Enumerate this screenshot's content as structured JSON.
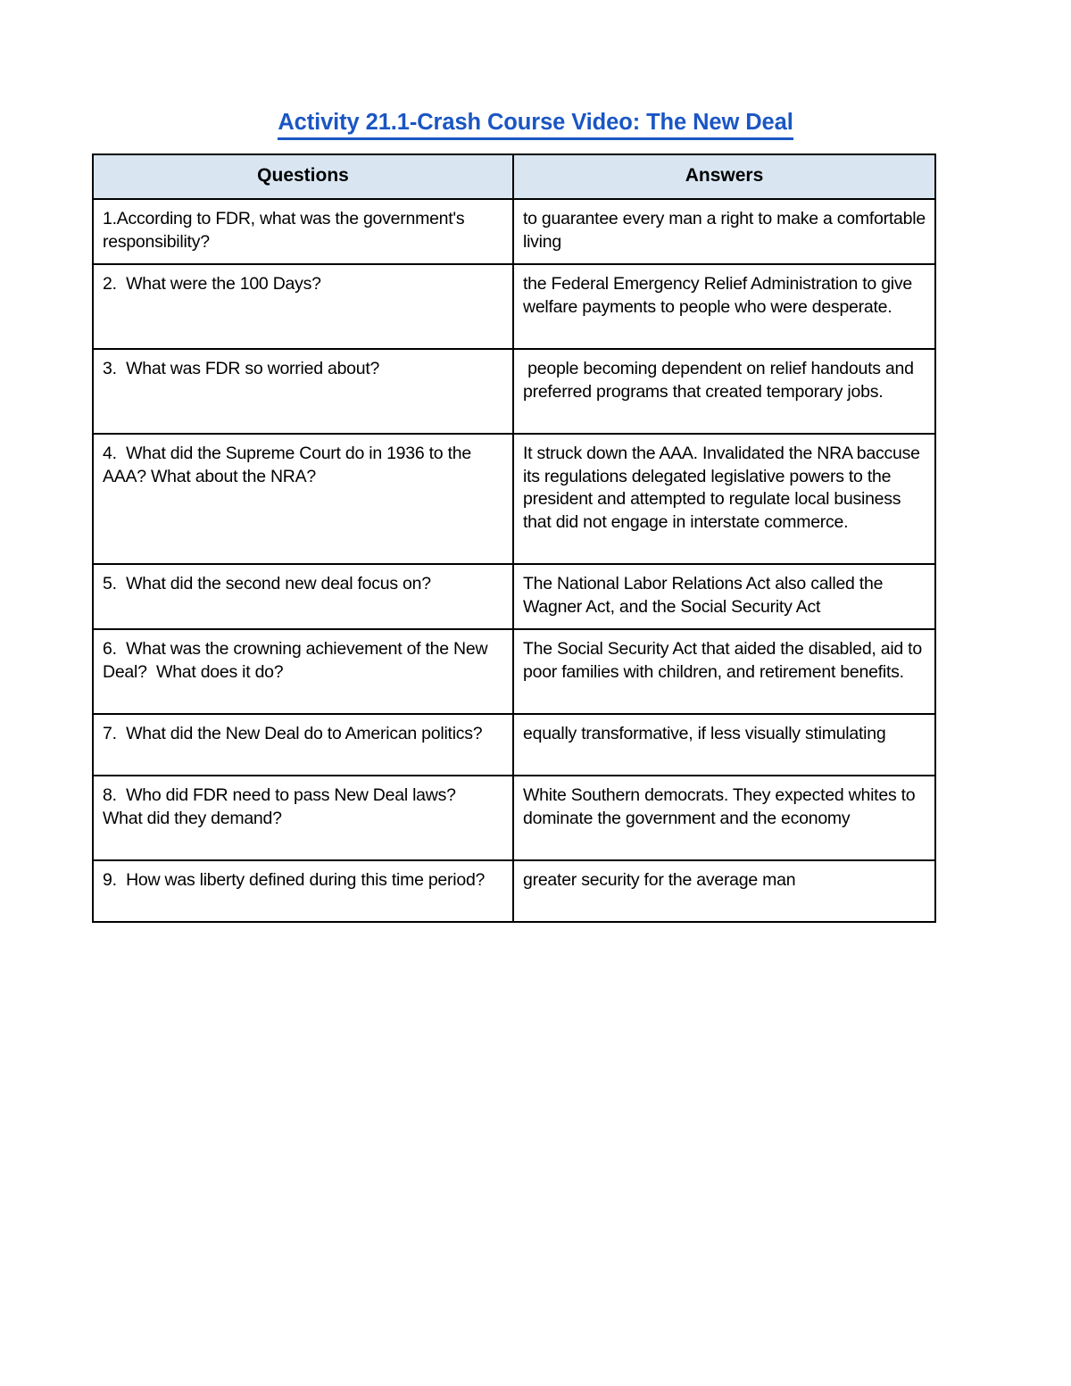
{
  "document": {
    "title": "Activity 21.1-Crash Course Video: The New Deal",
    "title_color": "#1a56c4",
    "background_color": "#ffffff",
    "text_color": "#000000"
  },
  "table": {
    "header_fill": "#d9e6f2",
    "border_color": "#000000",
    "columns": [
      {
        "key": "question",
        "label": "Questions"
      },
      {
        "key": "answer",
        "label": "Answers"
      }
    ],
    "rows": [
      {
        "number": "1",
        "question": "1.According to FDR, what was the government's responsibility?",
        "answer": "to guarantee every man a right to make a comfortable living"
      },
      {
        "number": "2",
        "question": "2.  What were the 100 Days?",
        "answer": "the Federal Emergency Relief Administration to give welfare payments to people who were desperate."
      },
      {
        "number": "3",
        "question": "3.  What was FDR so worried about?",
        "answer": " people becoming dependent on relief handouts and preferred programs that created temporary jobs."
      },
      {
        "number": "4",
        "question": "4.  What did the Supreme Court do in 1936 to the AAA? What about the NRA?",
        "answer": "It struck down the AAA. Invalidated the NRA baccuse its regulations delegated legislative powers to the president and attempted to regulate local business that did not engage in interstate commerce."
      },
      {
        "number": "5",
        "question": "5.  What did the second new deal focus on?",
        "answer": "The National Labor Relations Act also called the Wagner Act, and the Social Security Act"
      },
      {
        "number": "6",
        "question": "6.  What was the crowning achievement of the New Deal?  What does it do?",
        "answer": "The Social Security Act that aided the disabled, aid to poor families with children, and retirement benefits."
      },
      {
        "number": "7",
        "question": "7.  What did the New Deal do to American politics?",
        "answer": "equally transformative, if less visually stimulating"
      },
      {
        "number": "8",
        "question": "8.  Who did FDR need to pass New Deal laws?  What did they demand?",
        "answer": "White Southern democrats. They expected whites to dominate the government and the economy"
      },
      {
        "number": "9",
        "question": "9.  How was liberty defined during this time period?",
        "answer": "greater security for the average man"
      }
    ]
  }
}
